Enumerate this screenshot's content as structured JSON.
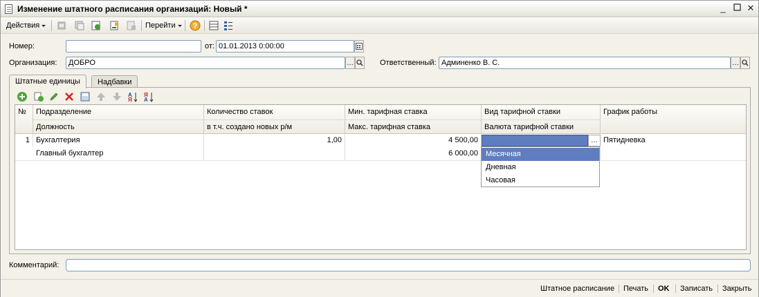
{
  "window": {
    "title": "Изменение штатного расписания организаций: Новый *"
  },
  "toolbar": {
    "actions_label": "Действия",
    "goto_label": "Перейти"
  },
  "form": {
    "number_label": "Номер:",
    "number_value": "",
    "date_label": "от:",
    "date_value": "01.01.2013  0:00:00",
    "org_label": "Организация:",
    "org_value": "ДОБРО",
    "responsible_label": "Ответственный:",
    "responsible_value": "Админенко В. С.",
    "comment_label": "Комментарий:",
    "comment_value": ""
  },
  "tabs": [
    {
      "label": "Штатные единицы",
      "active": true
    },
    {
      "label": "Надбавки",
      "active": false
    }
  ],
  "table": {
    "header_top": [
      "№",
      "Подразделение",
      "Количество ставок",
      "Мин. тарифная ставка",
      "Вид тарифной ставки",
      "График работы"
    ],
    "header_bottom": [
      "Должность",
      "в т.ч. создано новых р/м",
      "Макс. тарифная ставка",
      "Валюта тарифной ставки"
    ],
    "rows": [
      {
        "num": "1",
        "department": "Бухгалтерия",
        "position": "Главный бухгалтер",
        "rate_count": "1,00",
        "new_workplaces": "",
        "min_rate": "4 500,00",
        "max_rate": "6 000,00",
        "rate_type": "",
        "rate_currency": "",
        "schedule": "Пятидневка"
      }
    ]
  },
  "dropdown": {
    "options": [
      "Месячная",
      "Дневная",
      "Часовая"
    ],
    "selected": "Месячная"
  },
  "footer": {
    "buttons": [
      "Штатное расписание",
      "Печать",
      "OK",
      "Записать",
      "Закрыть"
    ]
  },
  "colors": {
    "selection": "#5f7ec0",
    "window_bg": "#f3f1e8",
    "field_border": "#7f9db9"
  }
}
